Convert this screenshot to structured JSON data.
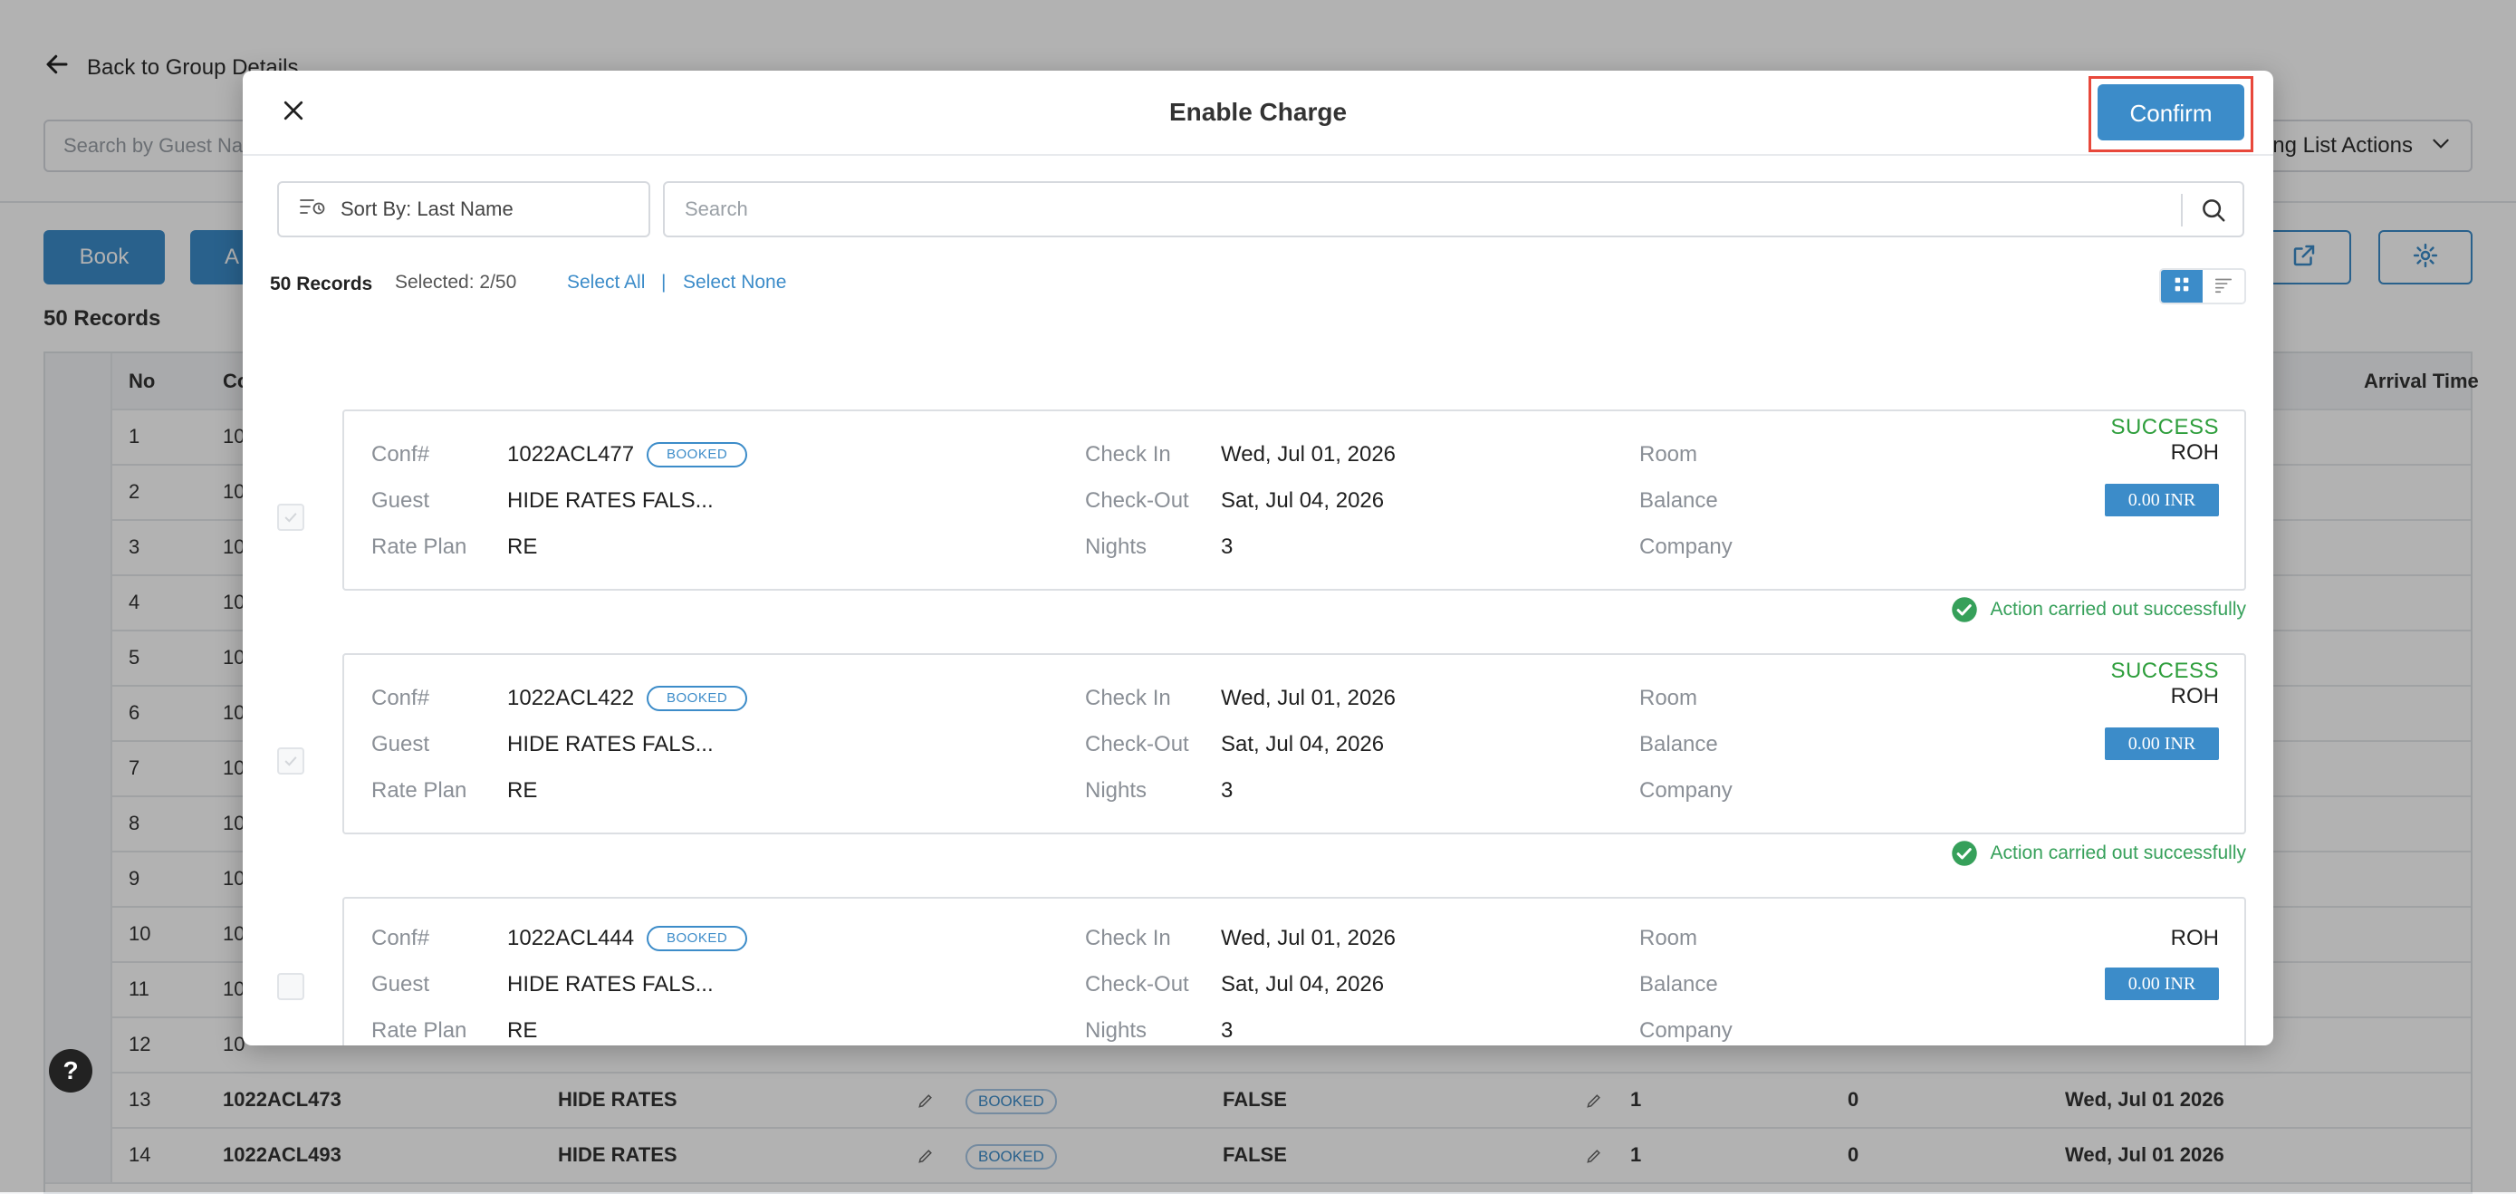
{
  "background": {
    "back_label": "Back to Group Details",
    "search_placeholder": "Search by Guest Name",
    "actions_label": "ng List Actions",
    "book_label": "Book",
    "second_btn_label": "A",
    "records_label": "50 Records",
    "table": {
      "col_no": "No",
      "col_conf": "Co",
      "col_arrival": "Arrival Time",
      "row_numbers": [
        "1",
        "2",
        "3",
        "4",
        "5",
        "6",
        "7",
        "8",
        "9",
        "10",
        "11",
        "12"
      ],
      "row_conf_prefix": "10",
      "rows_visible": [
        {
          "no": "13",
          "conf": "1022ACL473",
          "guest": "HIDE RATES",
          "status": "BOOKED",
          "flag": "FALSE",
          "n1": "1",
          "n2": "0",
          "date": "Wed, Jul 01 2026"
        },
        {
          "no": "14",
          "conf": "1022ACL493",
          "guest": "HIDE RATES",
          "status": "BOOKED",
          "flag": "FALSE",
          "n1": "1",
          "n2": "0",
          "date": "Wed, Jul 01 2026"
        }
      ]
    },
    "help_label": "?"
  },
  "modal": {
    "title": "Enable Charge",
    "confirm_label": "Confirm",
    "sort_label": "Sort By: Last Name",
    "search_placeholder": "Search",
    "records_count": "50 Records",
    "selected_count": "Selected: 2/50",
    "select_all": "Select All",
    "separator": "|",
    "select_none": "Select None",
    "labels": {
      "conf": "Conf#",
      "guest": "Guest",
      "rate_plan": "Rate Plan",
      "check_in": "Check In",
      "check_out": "Check-Out",
      "nights": "Nights",
      "room": "Room",
      "balance": "Balance",
      "company": "Company"
    },
    "records": [
      {
        "conf": "1022ACL477",
        "badge": "BOOKED",
        "guest": "HIDE RATES FALS...",
        "rate_plan": "RE",
        "check_in": "Wed, Jul 01, 2026",
        "check_out": "Sat, Jul 04, 2026",
        "nights": "3",
        "room": "ROH",
        "balance": "0.00 INR",
        "status": "SUCCESS",
        "message": "Action carried out successfully"
      },
      {
        "conf": "1022ACL422",
        "badge": "BOOKED",
        "guest": "HIDE RATES FALS...",
        "rate_plan": "RE",
        "check_in": "Wed, Jul 01, 2026",
        "check_out": "Sat, Jul 04, 2026",
        "nights": "3",
        "room": "ROH",
        "balance": "0.00 INR",
        "status": "SUCCESS",
        "message": "Action carried out successfully"
      },
      {
        "conf": "1022ACL444",
        "badge": "BOOKED",
        "guest": "HIDE RATES FALS...",
        "rate_plan": "RE",
        "check_in": "Wed, Jul 01, 2026",
        "check_out": "Sat, Jul 04, 2026",
        "nights": "3",
        "room": "ROH",
        "balance": "0.00 INR",
        "status": "",
        "message": ""
      }
    ]
  },
  "colors": {
    "accent": "#3c8cc9",
    "success": "#2e9e3c",
    "highlight": "#e8483b"
  }
}
